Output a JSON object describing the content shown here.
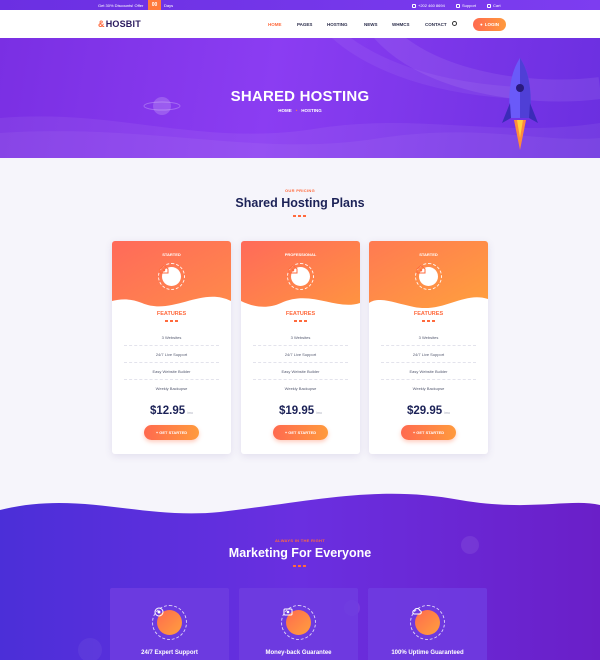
{
  "topbar": {
    "promo": "Get 30% Discounts! Offer",
    "days_count": "00",
    "days_label": "Days",
    "phone": "+202 460 8694",
    "support": "Support",
    "cart": "Cart"
  },
  "nav": {
    "logo": "HOSBIT",
    "items": [
      "HOME",
      "PAGES",
      "HOSTING",
      "NEWS",
      "WHMCS",
      "CONTACT"
    ],
    "login": "LOGIN"
  },
  "hero": {
    "title": "SHARED HOSTING",
    "breadcrumb": [
      "HOME",
      "HOSTING"
    ]
  },
  "pricing": {
    "eyebrow": "OUR PRICING",
    "title": "Shared Hosting Plans",
    "plans": [
      {
        "tier": "STARTED",
        "features_title": "FEATURES",
        "features": [
          "3 Websites",
          "24/7 Live Support",
          "Easy Website Builder",
          "Weekly Backupse"
        ],
        "price": "$12.95",
        "period": "/mo",
        "cta": "+ GET STARTED"
      },
      {
        "tier": "PROFESSIONAL",
        "features_title": "FEATURES",
        "features": [
          "3 Websites",
          "24/7 Live Support",
          "Easy Website Builder",
          "Weekly Backupse"
        ],
        "price": "$19.95",
        "period": "/mo",
        "cta": "+ GET STARTED"
      },
      {
        "tier": "STARTED",
        "features_title": "FEATURES",
        "features": [
          "3 Websites",
          "24/7 Live Support",
          "Easy Website Builder",
          "Weekly Backupse"
        ],
        "price": "$29.95",
        "period": "/mo",
        "cta": "+ GET STARTED"
      }
    ]
  },
  "marketing": {
    "eyebrow": "ALWAYS IN THE RIGHT",
    "title": "Marketing For Everyone",
    "features": [
      "24/7 Expert Support",
      "Money-back Guarantee",
      "100% Uptime Guaranteed"
    ]
  },
  "colors": {
    "primary": "#7b2fe6",
    "accent": "#ff6a3d",
    "heading": "#1c2257"
  },
  "icons": [
    "phone-icon",
    "support-icon",
    "cart-icon",
    "search-icon",
    "user-icon",
    "planet-icon",
    "rocket-icon",
    "house-icon",
    "support-expert-icon",
    "money-icon",
    "cloud-uptime-icon"
  ]
}
